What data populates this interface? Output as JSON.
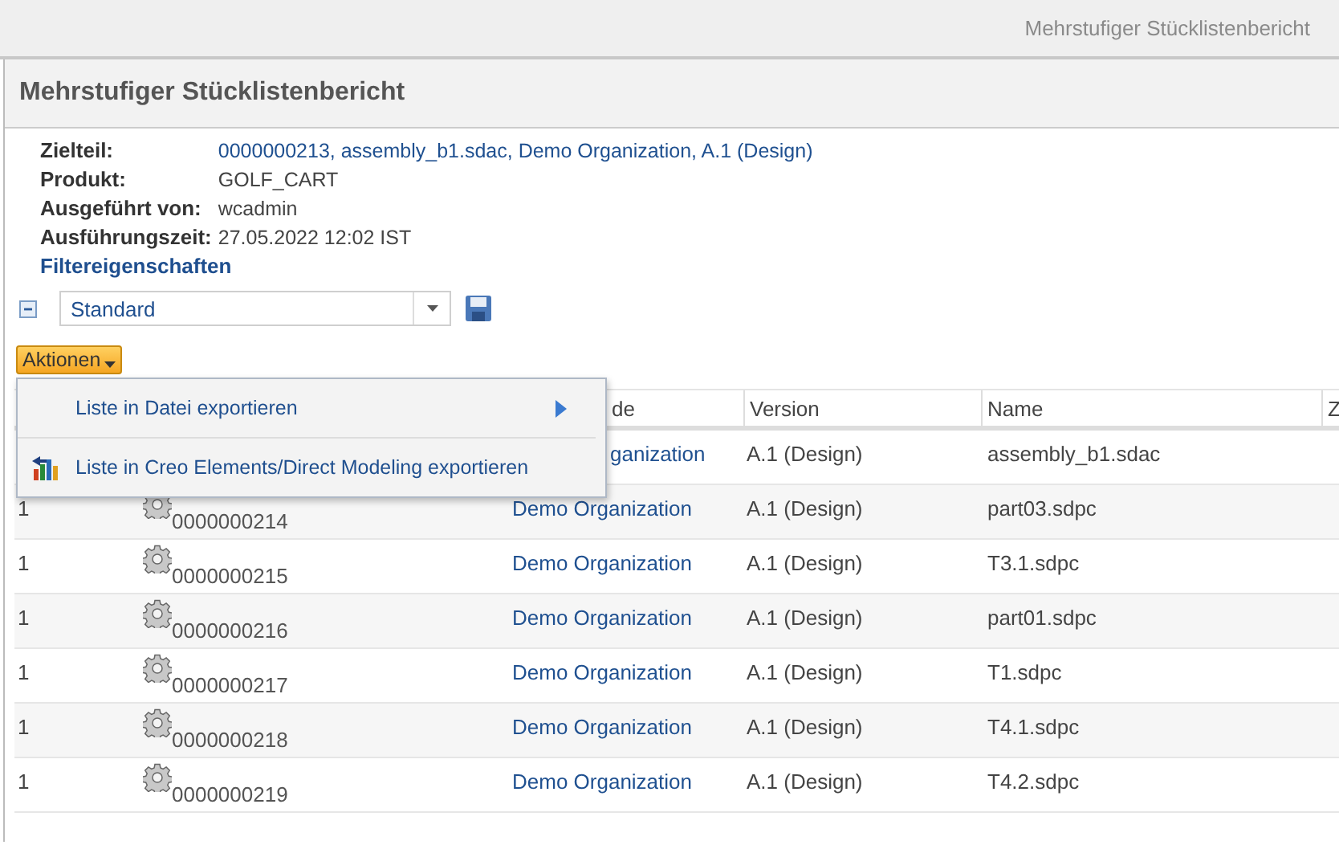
{
  "window": {
    "title": "Mehrstufiger Stücklistenbericht"
  },
  "panel": {
    "title": "Mehrstufiger Stücklistenbericht"
  },
  "info": [
    {
      "label": "Zielteil:",
      "value": "0000000213, assembly_b1.sdac, Demo Organization, A.1 (Design)",
      "kind": "link"
    },
    {
      "label": "Produkt:",
      "value": "GOLF_CART",
      "kind": "text"
    },
    {
      "label": "Ausgeführt von:",
      "value": "wcadmin",
      "kind": "text"
    },
    {
      "label": "Ausführungszeit:",
      "value": "27.05.2022 12:02 IST",
      "kind": "text"
    }
  ],
  "filter_heading": "Filtereigenschaften",
  "filter": {
    "expanded": true,
    "value": "Standard"
  },
  "actions_button": "Aktionen",
  "actions_menu": [
    {
      "label": "Liste in Datei exportieren",
      "kind": "submenu"
    },
    {
      "label": "Liste in Creo Elements/Direct Modeling exportieren",
      "kind": "export"
    }
  ],
  "table": {
    "columns": [
      {
        "label": "de",
        "clipped": true
      },
      {
        "label": "Version",
        "clipped": false
      },
      {
        "label": "Name",
        "clipped": false
      },
      {
        "label": "Z",
        "clipped": false
      }
    ],
    "rows": [
      {
        "level": "",
        "number": "",
        "organization": "ganization",
        "org_clipped": true,
        "version": "A.1 (Design)",
        "name": "assembly_b1.sdac"
      },
      {
        "level": "1",
        "number": "0000000214",
        "organization": "Demo Organization",
        "org_clipped": false,
        "version": "A.1 (Design)",
        "name": "part03.sdpc"
      },
      {
        "level": "1",
        "number": "0000000215",
        "organization": "Demo Organization",
        "org_clipped": false,
        "version": "A.1 (Design)",
        "name": "T3.1.sdpc"
      },
      {
        "level": "1",
        "number": "0000000216",
        "organization": "Demo Organization",
        "org_clipped": false,
        "version": "A.1 (Design)",
        "name": "part01.sdpc"
      },
      {
        "level": "1",
        "number": "0000000217",
        "organization": "Demo Organization",
        "org_clipped": false,
        "version": "A.1 (Design)",
        "name": "T1.sdpc"
      },
      {
        "level": "1",
        "number": "0000000218",
        "organization": "Demo Organization",
        "org_clipped": false,
        "version": "A.1 (Design)",
        "name": "T4.1.sdpc"
      },
      {
        "level": "1",
        "number": "0000000219",
        "organization": "Demo Organization",
        "org_clipped": false,
        "version": "A.1 (Design)",
        "name": "T4.2.sdpc"
      }
    ]
  }
}
